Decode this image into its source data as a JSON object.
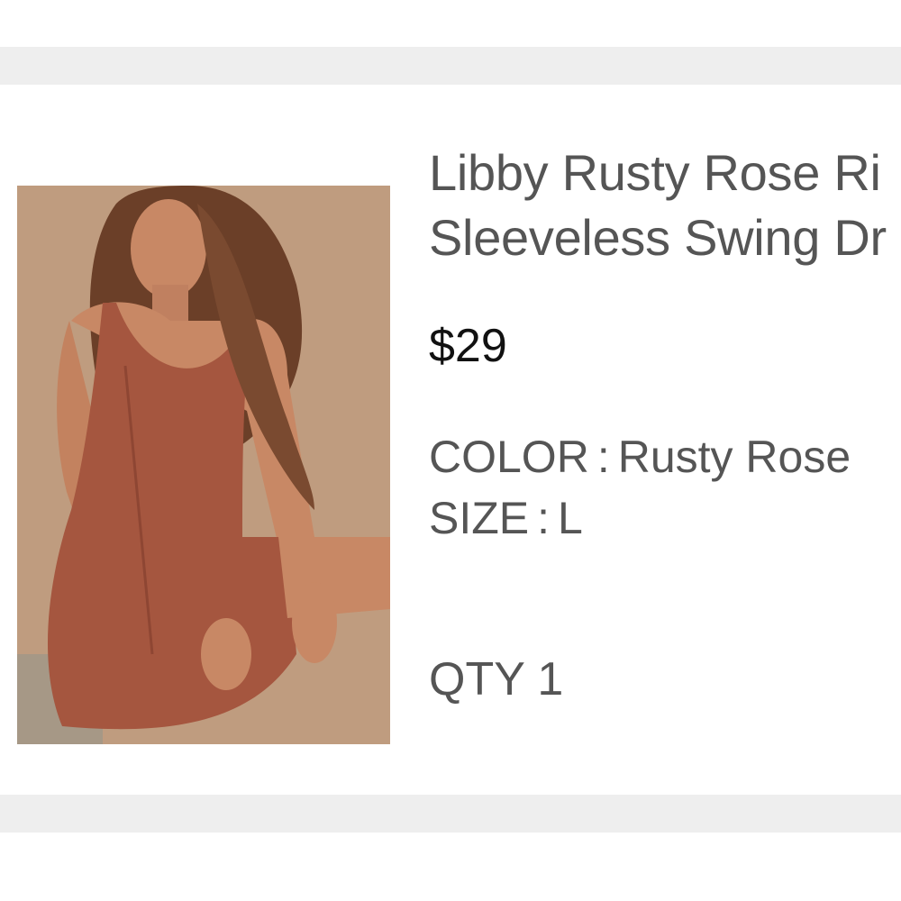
{
  "product": {
    "title_line1": "Libby Rusty Rose Ri",
    "title_line2": "Sleeveless Swing Dr",
    "price": "$29",
    "color_label": "COLOR",
    "color_value": "Rusty Rose",
    "size_label": "SIZE",
    "size_value": "L",
    "qty_label": "QTY",
    "qty_value": "1",
    "separator": ":"
  },
  "image": {
    "subject": "model-wearing-rust-ribbed-sleeveless-dress",
    "colors": {
      "background": "#c4a286",
      "dress": "#a5563f",
      "skin": "#c88865",
      "hair": "#6b3f28"
    }
  }
}
